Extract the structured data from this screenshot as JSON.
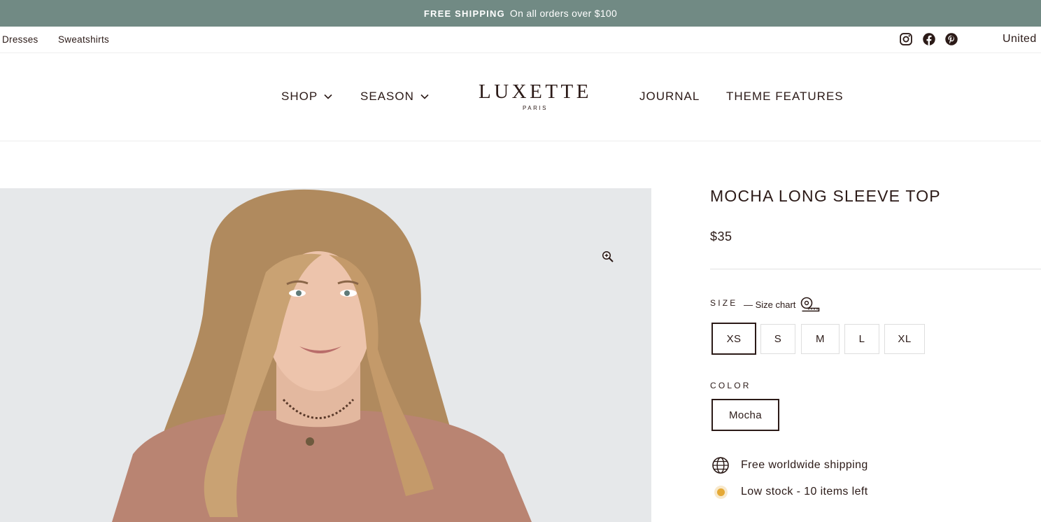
{
  "announcement": {
    "strong": "FREE SHIPPING",
    "text": "On all orders over $100"
  },
  "utility": {
    "links": [
      "Dresses",
      "Sweatshirts"
    ],
    "social": [
      "instagram-icon",
      "facebook-icon",
      "pinterest-icon"
    ],
    "region": "United"
  },
  "nav": {
    "left": [
      "SHOP",
      "SEASON"
    ],
    "right": [
      "JOURNAL",
      "THEME FEATURES"
    ],
    "logo": "LUXETTE",
    "logo_sub": "PARIS"
  },
  "product": {
    "title": "MOCHA LONG SLEEVE TOP",
    "price": "$35",
    "size_label": "SIZE",
    "size_chart": "— Size chart",
    "sizes": [
      "XS",
      "S",
      "M",
      "L",
      "XL"
    ],
    "selected_size": "XS",
    "color_label": "COLOR",
    "colors": [
      "Mocha"
    ],
    "selected_color": "Mocha"
  },
  "features": [
    {
      "icon": "globe-icon",
      "text": "Free worldwide shipping"
    },
    {
      "icon": "stock-dot-icon",
      "text": "Low stock - 10 items left"
    }
  ],
  "colors": {
    "announcement_bg": "#718a84",
    "text": "#2b1a17",
    "stock_dot": "#e5a935",
    "photo_bg": "#e6e8ea",
    "shirt": "#b98472"
  }
}
